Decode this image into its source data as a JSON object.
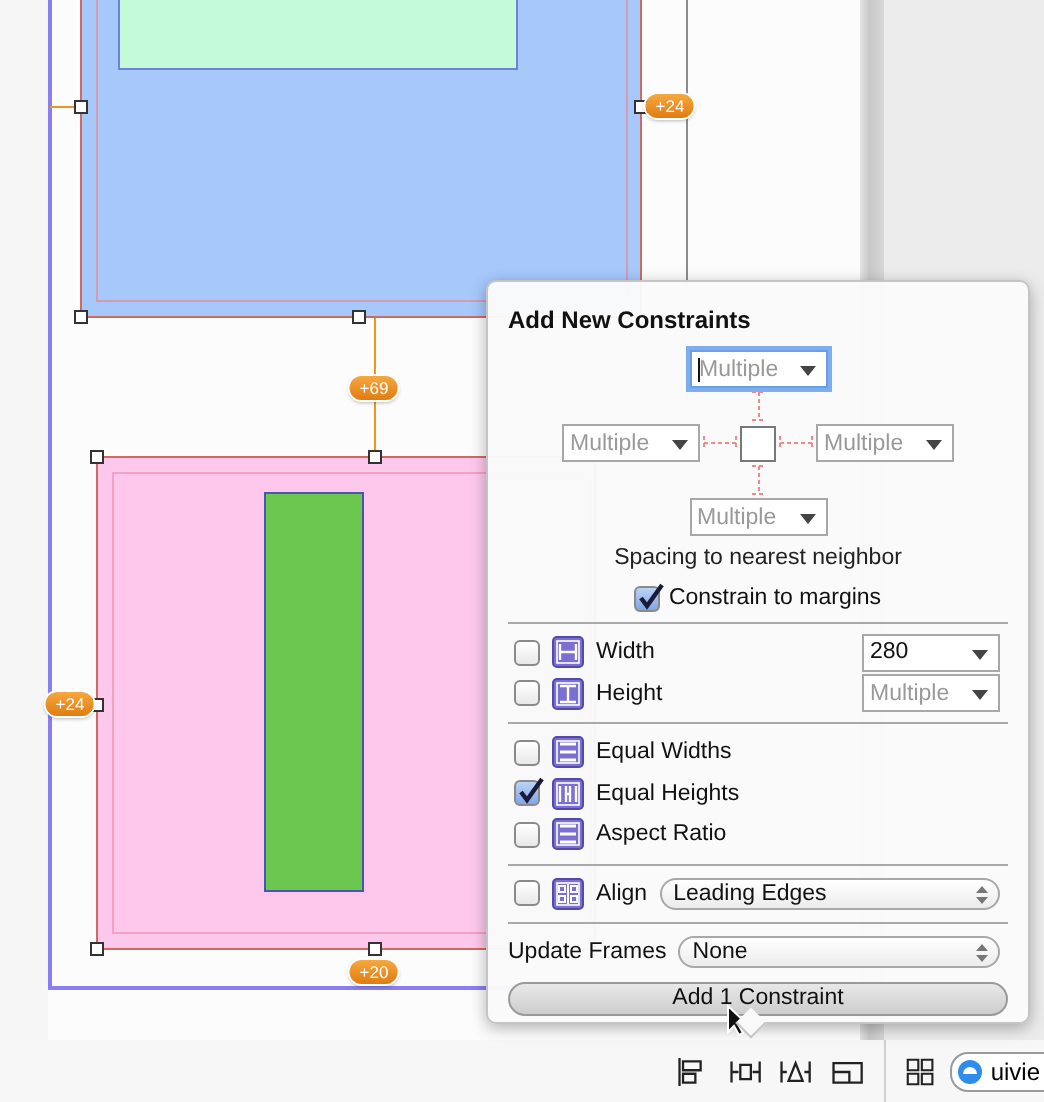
{
  "canvas": {
    "badges": [
      {
        "text": "+24"
      },
      {
        "text": "+69"
      },
      {
        "text": "+24"
      },
      {
        "text": "+20"
      }
    ]
  },
  "popover": {
    "title": "Add New Constraints",
    "spacing": {
      "top": {
        "placeholder": "Multiple",
        "focused": true
      },
      "left": {
        "placeholder": "Multiple",
        "focused": false
      },
      "right": {
        "placeholder": "Multiple",
        "focused": false
      },
      "bottom": {
        "placeholder": "Multiple",
        "focused": false
      }
    },
    "spacing_caption": "Spacing to nearest neighbor",
    "constrain_to_margins": {
      "label": "Constrain to margins",
      "checked": true
    },
    "size": [
      {
        "label": "Width",
        "checked": false,
        "value": "280"
      },
      {
        "label": "Height",
        "checked": false,
        "placeholder": "Multiple"
      }
    ],
    "equal": [
      {
        "label": "Equal Widths",
        "checked": false
      },
      {
        "label": "Equal Heights",
        "checked": true
      },
      {
        "label": "Aspect Ratio",
        "checked": false
      }
    ],
    "align": {
      "label": "Align",
      "checked": false,
      "value": "Leading Edges"
    },
    "update_frames": {
      "label": "Update Frames",
      "value": "None"
    },
    "add_button": "Add 1 Constraint"
  },
  "toolbar": {
    "scheme": "uivie"
  }
}
